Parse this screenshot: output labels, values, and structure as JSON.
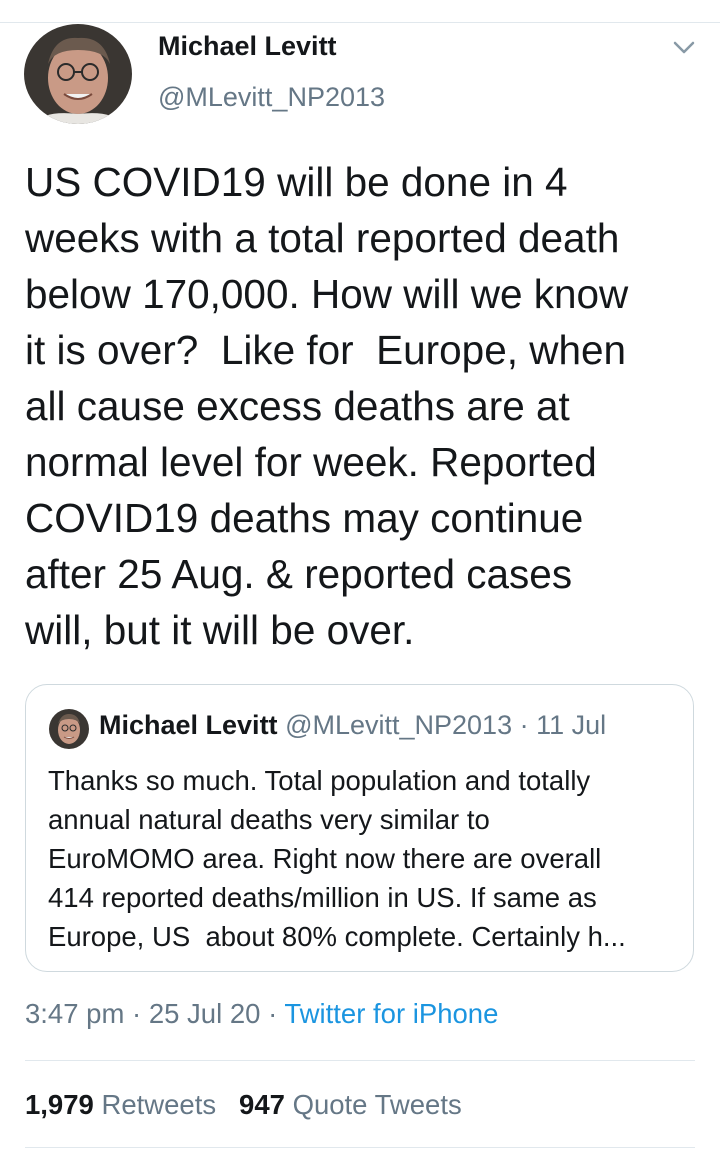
{
  "tweet": {
    "author": {
      "name": "Michael Levitt",
      "handle": "@MLevitt_NP2013"
    },
    "text": "US COVID19 will be done in 4\nweeks with a total reported death\nbelow 170,000. How will we know\nit is over?  Like for  Europe, when\nall cause excess deaths are at\nnormal level for week. Reported\nCOVID19 deaths may continue\nafter 25 Aug. & reported cases\nwill, but it will be over.",
    "quoted": {
      "name": "Michael Levitt",
      "handle": "@MLevitt_NP2013",
      "separator": " · ",
      "date": "11 Jul",
      "text": "Thanks so much. Total population and totally\nannual natural deaths very similar to\nEuroMOMO area. Right now there are overall\n414 reported deaths/million in US. If same as\nEurope, US  about 80% complete. Certainly h..."
    },
    "time": "3:47 pm",
    "separator": " · ",
    "date": "25 Jul 20",
    "source": "Twitter for iPhone",
    "stats": {
      "retweets_count": "1,979",
      "retweets_label": "Retweets",
      "quotes_count": "947",
      "quotes_label": "Quote Tweets"
    }
  },
  "icons": {
    "more": "chevron-down-icon",
    "avatar": "avatar-photo"
  },
  "colors": {
    "text": "#14171a",
    "secondary": "#657786",
    "link": "#1b95e0",
    "border": "#cfd9de"
  }
}
